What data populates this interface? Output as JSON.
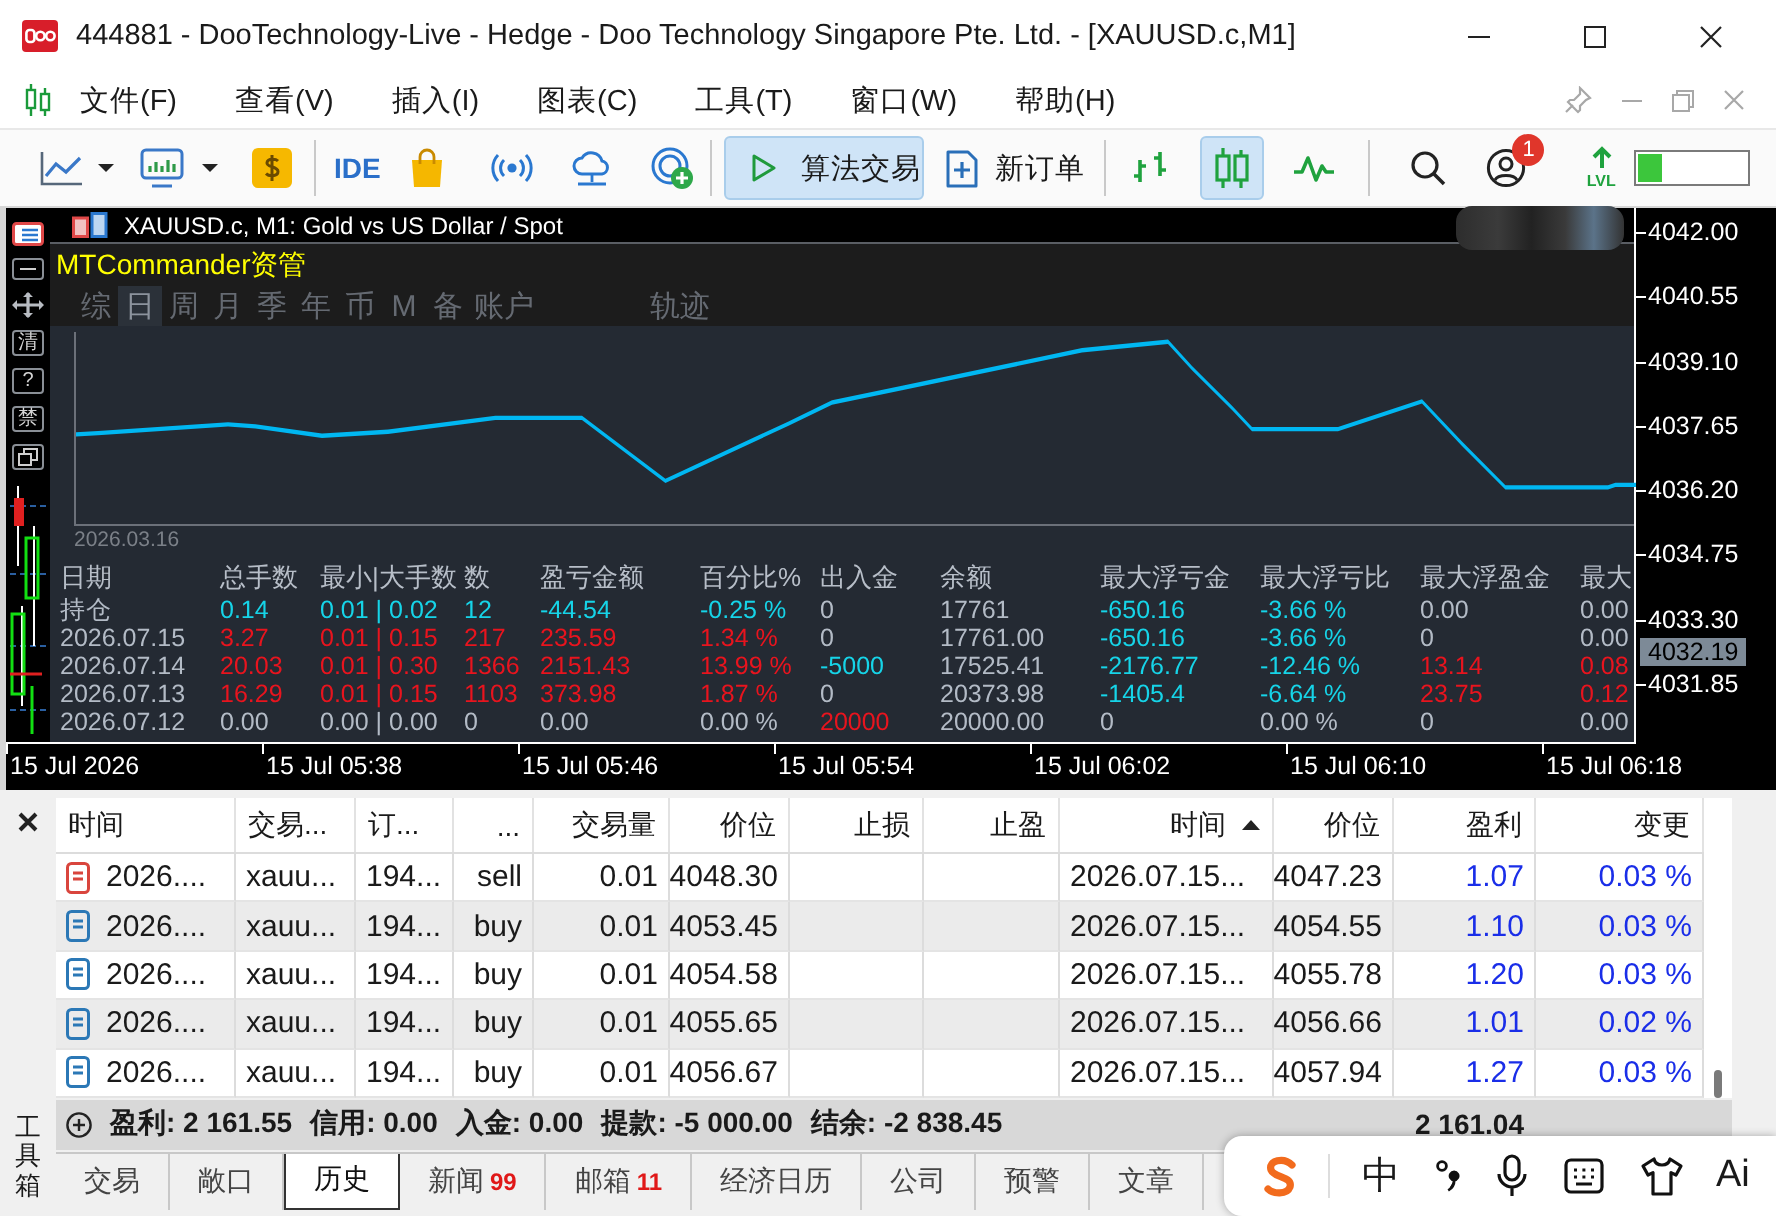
{
  "window": {
    "title": "444881 - DooTechnology-Live - Hedge - Doo Technology Singapore Pte. Ltd. - [XAUUSD.c,M1]"
  },
  "menu": {
    "items": [
      "文件(F)",
      "查看(V)",
      "插入(I)",
      "图表(C)",
      "工具(T)",
      "窗口(W)",
      "帮助(H)"
    ]
  },
  "toolbar": {
    "ide_label": "IDE",
    "algo_trading": {
      "label": "算法交易",
      "on": true
    },
    "new_order": {
      "label": "新订单"
    },
    "chart_types": [
      {
        "kind": "bars",
        "selected": false
      },
      {
        "kind": "candles",
        "selected": true
      },
      {
        "kind": "line",
        "selected": false
      }
    ],
    "account_badge": "1",
    "level_label": "LVL",
    "level": 0.22
  },
  "chart": {
    "title": "XAUUSD.c, M1: Gold vs US Dollar / Spot",
    "price_labels": [
      "4042.00",
      "4040.55",
      "4039.10",
      "4037.65",
      "4036.20",
      "4034.75",
      "4033.30",
      "4031.85"
    ],
    "current_price": "4032.19",
    "time_labels": [
      "15 Jul 2026",
      "15 Jul 05:38",
      "15 Jul 05:46",
      "15 Jul 05:54",
      "15 Jul 06:02",
      "15 Jul 06:10",
      "15 Jul 06:18"
    ]
  },
  "commander": {
    "title": "MTCommander资管",
    "side_buttons": [
      {
        "kind": "minimize"
      },
      {
        "kind": "move"
      },
      {
        "kind": "text",
        "label": "清"
      },
      {
        "kind": "text",
        "label": "?"
      },
      {
        "kind": "text",
        "label": "禁"
      },
      {
        "kind": "restore"
      }
    ],
    "tabs": [
      {
        "label": "综",
        "selected": false
      },
      {
        "label": "日",
        "selected": true
      },
      {
        "label": "周",
        "selected": false
      },
      {
        "label": "月",
        "selected": false
      },
      {
        "label": "季",
        "selected": false
      },
      {
        "label": "年",
        "selected": false
      },
      {
        "label": "币",
        "selected": false
      },
      {
        "label": "M",
        "selected": false
      },
      {
        "label": "备",
        "selected": false
      },
      {
        "label": "账户",
        "selected": false
      }
    ],
    "trail_tab": {
      "label": "轨迹",
      "selected": false
    },
    "curve_start_date": "2026.03.16",
    "table": {
      "columns": [
        "日期",
        "总手数",
        "最小|大手数",
        "数",
        "盈亏金额",
        "百分比%",
        "出入金",
        "余额",
        "最大浮亏金",
        "最大浮亏比",
        "最大浮盈金",
        "最大"
      ],
      "rows": [
        {
          "cells": [
            {
              "text": "持仓",
              "color": "#b3bbc6"
            },
            {
              "text": "0.14",
              "color": "#16d4e8"
            },
            {
              "text": "0.01 | 0.02",
              "color": "#16d4e8"
            },
            {
              "text": "12",
              "color": "#16d4e8"
            },
            {
              "text": "-44.54",
              "color": "#16d4e8"
            },
            {
              "text": "-0.25 %",
              "color": "#16d4e8"
            },
            {
              "text": "0",
              "color": "#b3bbc6"
            },
            {
              "text": "17761",
              "color": "#b3bbc6"
            },
            {
              "text": "-650.16",
              "color": "#16d4e8"
            },
            {
              "text": "-3.66 %",
              "color": "#16d4e8"
            },
            {
              "text": "0.00",
              "color": "#b3bbc6"
            },
            {
              "text": "0.00",
              "color": "#b3bbc6"
            }
          ]
        },
        {
          "cells": [
            {
              "text": "2026.07.15",
              "color": "#b3bbc6"
            },
            {
              "text": "3.27",
              "color": "#e8141e"
            },
            {
              "text": "0.01 | 0.15",
              "color": "#e8141e"
            },
            {
              "text": "217",
              "color": "#e8141e"
            },
            {
              "text": "235.59",
              "color": "#e8141e"
            },
            {
              "text": "1.34 %",
              "color": "#e8141e"
            },
            {
              "text": "0",
              "color": "#b3bbc6"
            },
            {
              "text": "17761.00",
              "color": "#b3bbc6"
            },
            {
              "text": "-650.16",
              "color": "#16d4e8"
            },
            {
              "text": "-3.66 %",
              "color": "#16d4e8"
            },
            {
              "text": "0",
              "color": "#b3bbc6"
            },
            {
              "text": "0.00",
              "color": "#b3bbc6"
            }
          ]
        },
        {
          "cells": [
            {
              "text": "2026.07.14",
              "color": "#b3bbc6"
            },
            {
              "text": "20.03",
              "color": "#e8141e"
            },
            {
              "text": "0.01 | 0.30",
              "color": "#e8141e"
            },
            {
              "text": "1366",
              "color": "#e8141e"
            },
            {
              "text": "2151.43",
              "color": "#e8141e"
            },
            {
              "text": "13.99 %",
              "color": "#e8141e"
            },
            {
              "text": "-5000",
              "color": "#16d4e8"
            },
            {
              "text": "17525.41",
              "color": "#b3bbc6"
            },
            {
              "text": "-2176.77",
              "color": "#16d4e8"
            },
            {
              "text": "-12.46 %",
              "color": "#16d4e8"
            },
            {
              "text": "13.14",
              "color": "#e8141e"
            },
            {
              "text": "0.08",
              "color": "#e8141e"
            }
          ]
        },
        {
          "cells": [
            {
              "text": "2026.07.13",
              "color": "#b3bbc6"
            },
            {
              "text": "16.29",
              "color": "#e8141e"
            },
            {
              "text": "0.01 | 0.15",
              "color": "#e8141e"
            },
            {
              "text": "1103",
              "color": "#e8141e"
            },
            {
              "text": "373.98",
              "color": "#e8141e"
            },
            {
              "text": "1.87 %",
              "color": "#e8141e"
            },
            {
              "text": "0",
              "color": "#b3bbc6"
            },
            {
              "text": "20373.98",
              "color": "#b3bbc6"
            },
            {
              "text": "-1405.4",
              "color": "#16d4e8"
            },
            {
              "text": "-6.64 %",
              "color": "#16d4e8"
            },
            {
              "text": "23.75",
              "color": "#e8141e"
            },
            {
              "text": "0.12",
              "color": "#e8141e"
            }
          ]
        },
        {
          "cells": [
            {
              "text": "2026.07.12",
              "color": "#b3bbc6"
            },
            {
              "text": "0.00",
              "color": "#b3bbc6"
            },
            {
              "text": "0.00 | 0.00",
              "color": "#b3bbc6"
            },
            {
              "text": "0",
              "color": "#b3bbc6"
            },
            {
              "text": "0.00",
              "color": "#b3bbc6"
            },
            {
              "text": "0.00 %",
              "color": "#b3bbc6"
            },
            {
              "text": "20000",
              "color": "#e8141e"
            },
            {
              "text": "20000.00",
              "color": "#b3bbc6"
            },
            {
              "text": "0",
              "color": "#b3bbc6"
            },
            {
              "text": "0.00 %",
              "color": "#b3bbc6"
            },
            {
              "text": "0",
              "color": "#b3bbc6"
            },
            {
              "text": "0.00",
              "color": "#b3bbc6"
            }
          ]
        }
      ]
    }
  },
  "terminal": {
    "columns": [
      {
        "label": "时间",
        "sorted": false
      },
      {
        "label": "交易...",
        "sorted": false
      },
      {
        "label": "订...",
        "sorted": false
      },
      {
        "label": "...",
        "sorted": false
      },
      {
        "label": "交易量",
        "sorted": false
      },
      {
        "label": "价位",
        "sorted": false
      },
      {
        "label": "止损",
        "sorted": false
      },
      {
        "label": "止盈",
        "sorted": false
      },
      {
        "label": "时间",
        "sorted": true
      },
      {
        "label": "价位",
        "sorted": false
      },
      {
        "label": "盈利",
        "sorted": false
      },
      {
        "label": "变更",
        "sorted": false
      }
    ],
    "rows": [
      {
        "kind": "sell",
        "time": "2026....",
        "symbol": "xauu...",
        "ticket": "194...",
        "type": "sell",
        "volume": "0.01",
        "price": "4048.30",
        "close_time": "2026.07.15...",
        "close_price": "4047.23",
        "profit": "1.07",
        "change": "0.03 %"
      },
      {
        "kind": "buy",
        "time": "2026....",
        "symbol": "xauu...",
        "ticket": "194...",
        "type": "buy",
        "volume": "0.01",
        "price": "4053.45",
        "close_time": "2026.07.15...",
        "close_price": "4054.55",
        "profit": "1.10",
        "change": "0.03 %"
      },
      {
        "kind": "buy",
        "time": "2026....",
        "symbol": "xauu...",
        "ticket": "194...",
        "type": "buy",
        "volume": "0.01",
        "price": "4054.58",
        "close_time": "2026.07.15...",
        "close_price": "4055.78",
        "profit": "1.20",
        "change": "0.03 %"
      },
      {
        "kind": "buy",
        "time": "2026....",
        "symbol": "xauu...",
        "ticket": "194...",
        "type": "buy",
        "volume": "0.01",
        "price": "4055.65",
        "close_time": "2026.07.15...",
        "close_price": "4056.66",
        "profit": "1.01",
        "change": "0.02 %"
      },
      {
        "kind": "buy",
        "time": "2026....",
        "symbol": "xauu...",
        "ticket": "194...",
        "type": "buy",
        "volume": "0.01",
        "price": "4056.67",
        "close_time": "2026.07.15...",
        "close_price": "4057.94",
        "profit": "1.27",
        "change": "0.03 %"
      }
    ],
    "summary": {
      "items": [
        "盈利: 2 161.55",
        "信用: 0.00",
        "入金: 0.00",
        "提款: -5 000.00",
        "结余: -2 838.45"
      ],
      "total": "2 161.04"
    },
    "tabs": [
      {
        "label": "交易",
        "selected": false
      },
      {
        "label": "敞口",
        "selected": false
      },
      {
        "label": "历史",
        "selected": true
      },
      {
        "label": "新闻",
        "badge": "99",
        "selected": false
      },
      {
        "label": "邮箱",
        "badge": "11",
        "selected": false
      },
      {
        "label": "经济日历",
        "selected": false
      },
      {
        "label": "公司",
        "selected": false
      },
      {
        "label": "预警",
        "selected": false
      },
      {
        "label": "文章",
        "selected": false
      }
    ],
    "toolbox_label": "工具箱"
  },
  "ime_bar": {
    "items": [
      {
        "kind": "logo"
      },
      {
        "kind": "text",
        "label": "中"
      },
      {
        "kind": "punctuation"
      },
      {
        "kind": "mic"
      },
      {
        "kind": "keyboard"
      },
      {
        "kind": "skin"
      },
      {
        "kind": "text",
        "label": "Ai"
      }
    ]
  }
}
